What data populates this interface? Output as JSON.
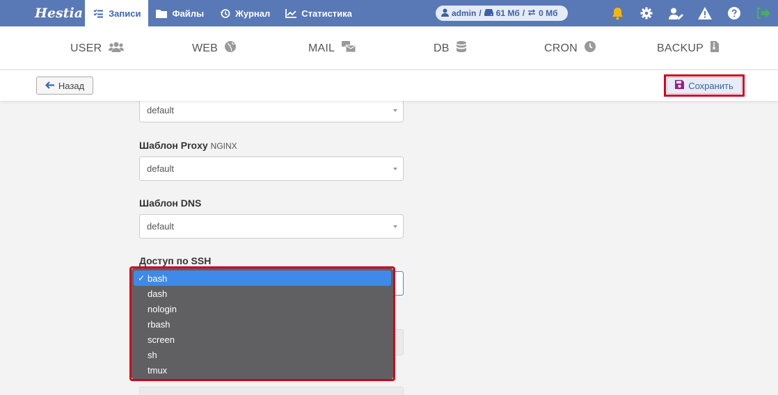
{
  "app": {
    "logo": "Hestia"
  },
  "topnav": [
    {
      "label": "Записи",
      "icon": "list-check-icon",
      "active": true
    },
    {
      "label": "Файлы",
      "icon": "folder-icon",
      "active": false
    },
    {
      "label": "Журнал",
      "icon": "history-icon",
      "active": false
    },
    {
      "label": "Статистика",
      "icon": "chart-line-icon",
      "active": false
    }
  ],
  "user": {
    "name": "admin",
    "sep1": "/",
    "disk": "61 Мб",
    "sep2": "/",
    "bandwidth": "0 Мб"
  },
  "subnav": [
    {
      "label": "USER",
      "icon": "users-icon"
    },
    {
      "label": "WEB",
      "icon": "globe-icon"
    },
    {
      "label": "MAIL",
      "icon": "mail-bulk-icon"
    },
    {
      "label": "DB",
      "icon": "database-icon"
    },
    {
      "label": "CRON",
      "icon": "clock-icon"
    },
    {
      "label": "BACKUP",
      "icon": "file-zip-icon"
    }
  ],
  "toolbar": {
    "back_label": "Назад",
    "save_label": "Сохранить"
  },
  "form": {
    "web_template_value": "default",
    "proxy_label": "Шаблон Proxy",
    "proxy_sub": "NGINX",
    "proxy_value": "default",
    "dns_label": "Шаблон DNS",
    "dns_value": "default",
    "ssh_label": "Доступ по SSH"
  },
  "ssh_options": [
    {
      "label": "bash",
      "selected": true,
      "check": "✓"
    },
    {
      "label": "dash",
      "selected": false
    },
    {
      "label": "nologin",
      "selected": false
    },
    {
      "label": "rbash",
      "selected": false
    },
    {
      "label": "screen",
      "selected": false
    },
    {
      "label": "sh",
      "selected": false
    },
    {
      "label": "tmux",
      "selected": false
    }
  ],
  "colors": {
    "topbar": "#5978b6",
    "accent": "#3d68b4",
    "highlight": "#d0021b",
    "notify": "#f1b70d",
    "logout": "#43b05c"
  }
}
